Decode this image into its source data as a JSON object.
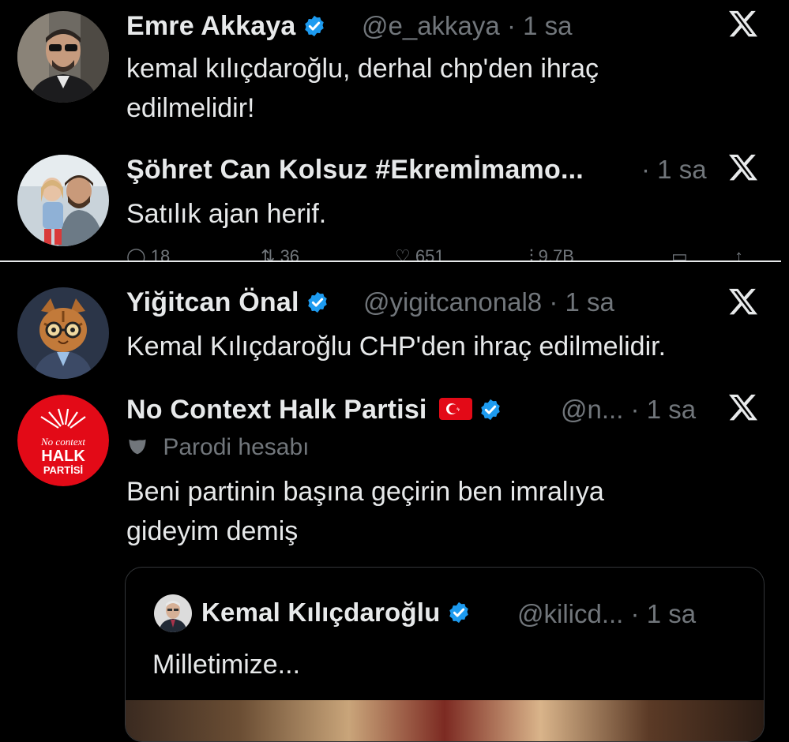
{
  "tweets": [
    {
      "name": "Emre Akkaya",
      "handle": "@e_akkaya",
      "time": "1 sa",
      "text_lines": [
        "kemal kılıçdaroğlu, derhal chp'den ihraç",
        "edilmelidir!"
      ]
    },
    {
      "name": "Şöhret Can Kolsuz #Ekremİmamo...",
      "time": "1 sa",
      "text_lines": [
        "Satılık ajan herif."
      ]
    },
    {
      "name": "Yiğitcan Önal",
      "handle": "@yigitcanonal8",
      "time": "1 sa",
      "text_lines": [
        "Kemal Kılıçdaroğlu CHP'den ihraç edilmelidir."
      ]
    },
    {
      "name": "No Context Halk Partisi",
      "flag": "🇹🇷",
      "handle": "@n...",
      "time": "1 sa",
      "label": "Parodi hesabı",
      "text_lines": [
        "Beni partinin başına geçirin ben imralıya",
        "gideyim demiş"
      ],
      "avatar_text": [
        "No context",
        "HALK",
        "PARTİSİ"
      ]
    }
  ],
  "partial_actions": {
    "reply": "18",
    "retweet": "36",
    "like": "651",
    "views": "9,7B"
  },
  "quote": {
    "name": "Kemal Kılıçdaroğlu",
    "handle": "@kilicd...",
    "time": "1 sa",
    "text": "Milletimize..."
  },
  "separator": "·",
  "colors": {
    "background": "#000000",
    "text": "#e7e9ea",
    "muted": "#71767b",
    "verified": "#1d9bf0",
    "chp_red": "#e30a17"
  }
}
